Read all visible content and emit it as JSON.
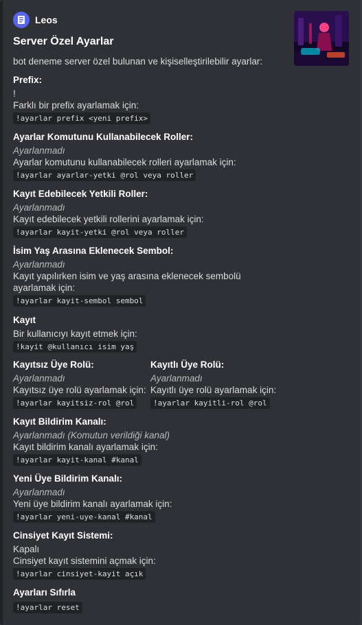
{
  "author": {
    "name": "Leos",
    "icon": "bot-avatar-icon"
  },
  "title": "Server Özel Ayarlar",
  "description": "bot deneme server özel bulunan ve kişiselleştirilebilir ayarlar:",
  "thumbnail": "neon-city-character-image",
  "fields": {
    "prefix": {
      "name": "Prefix:",
      "value": "!",
      "hint": "Farklı bir prefix ayarlamak için:",
      "command": "!ayarlar prefix <yeni prefix>"
    },
    "admin_roles": {
      "name": "Ayarlar Komutunu Kullanabilecek Roller:",
      "value": "Ayarlanmadı",
      "hint": "Ayarlar komutunu kullanabilecek rolleri ayarlamak için:",
      "command": "!ayarlar ayarlar-yetki @rol veya roller"
    },
    "register_roles": {
      "name": "Kayıt Edebilecek Yetkili Roller:",
      "value": "Ayarlanmadı",
      "hint": "Kayıt edebilecek yetkili rollerini ayarlamak için:",
      "command": "!ayarlar kayit-yetki @rol veya roller"
    },
    "symbol": {
      "name": "İsim Yaş Arasına Eklenecek Sembol:",
      "value": "Ayarlanmadı",
      "hint": "Kayıt yapılırken isim ve yaş arasına eklenecek sembolü ayarlamak için:",
      "command": "!ayarlar kayit-sembol sembol"
    },
    "register": {
      "name": "Kayıt",
      "hint": "Bir kullanıcıyı kayıt etmek için:",
      "command": "!kayit @kullanıcı isim yaş"
    },
    "unregistered_role": {
      "name": "Kayıtsız Üye Rolü:",
      "value": "Ayarlanmadı",
      "hint": "Kayıtsız üye rolü ayarlamak için:",
      "command": "!ayarlar kayitsiz-rol @rol"
    },
    "registered_role": {
      "name": "Kayıtlı Üye Rolü:",
      "value": "Ayarlanmadı",
      "hint": "Kayıtlı üye rolü ayarlamak için:",
      "command": "!ayarlar kayitli-rol @rol"
    },
    "register_channel": {
      "name": "Kayıt Bildirim Kanalı:",
      "value": "Ayarlanmadı (Komutun verildiği kanal)",
      "hint": "Kayıt bildirim kanalı ayarlamak için:",
      "command": "!ayarlar kayit-kanal #kanal"
    },
    "welcome_channel": {
      "name": "Yeni Üye Bildirim Kanalı:",
      "value": "Ayarlanmadı",
      "hint": "Yeni üye bildirim kanalı ayarlamak için:",
      "command": "!ayarlar yeni-uye-kanal #kanal"
    },
    "gender": {
      "name": "Cinsiyet Kayıt Sistemi:",
      "value": "Kapalı",
      "hint": "Cinsiyet kayıt sistemini açmak için:",
      "command": "!ayarlar cinsiyet-kayit açık"
    },
    "reset": {
      "name": "Ayarları Sıfırla",
      "command": "!ayarlar reset"
    }
  }
}
